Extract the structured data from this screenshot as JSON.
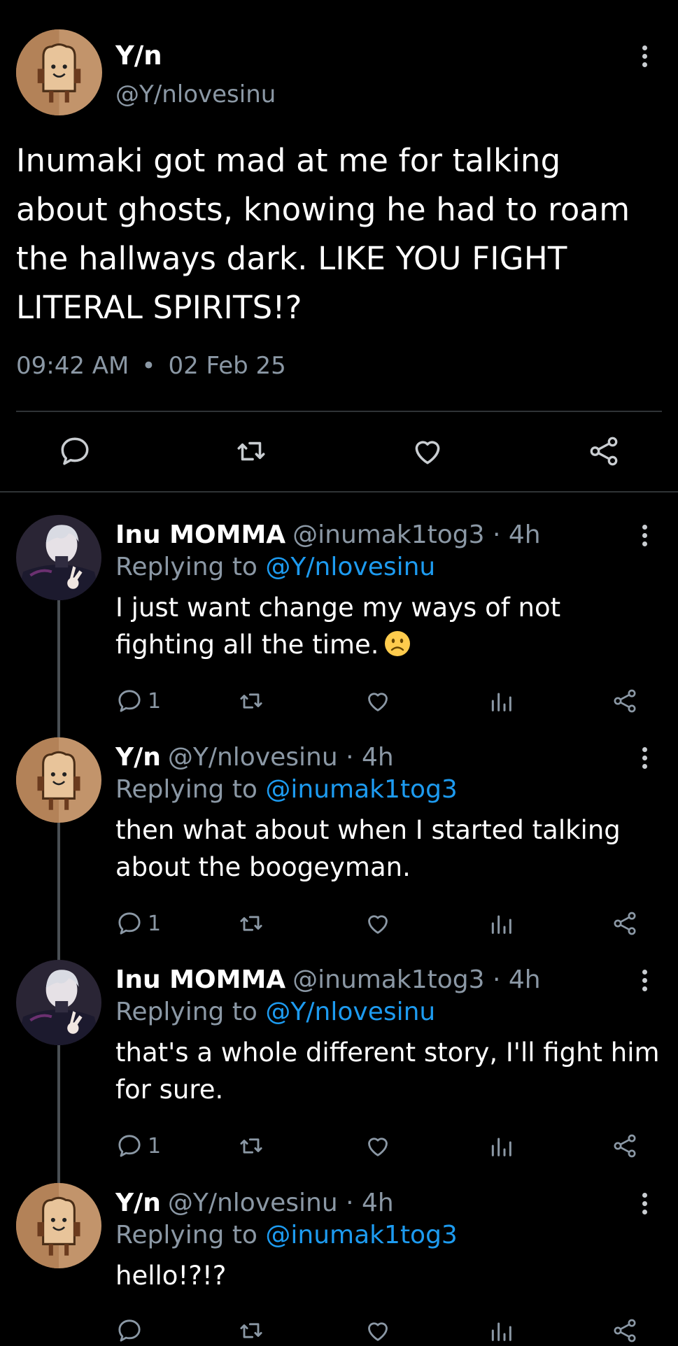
{
  "main_tweet": {
    "name": "Y/n",
    "handle": "@Y/nlovesinu",
    "text": "Inumaki got mad at me for talking about ghosts, knowing he had to roam the hallways dark. LIKE YOU FIGHT LITERAL SPIRITS!?",
    "time": "09:42 AM",
    "separator": "•",
    "date": "02 Feb 25",
    "actions": [
      "reply-icon",
      "retweet-icon",
      "like-icon",
      "share-icon"
    ]
  },
  "replies": [
    {
      "name": "Inu MOMMA",
      "handle_time": "@inumak1tog3 · 4h",
      "replying_prefix": "Replying to",
      "replying_to": "@Y/nlovesinu",
      "text": "I just want change my ways of not fighting all the time.",
      "emoji": "slightly-frowning-face-icon",
      "reply_count": "1"
    },
    {
      "name": "Y/n",
      "handle_time": "@Y/nlovesinu · 4h",
      "replying_prefix": "Replying to",
      "replying_to": "@inumak1tog3",
      "text": "then what about when I started talking about the boogeyman.",
      "reply_count": "1"
    },
    {
      "name": "Inu MOMMA",
      "handle_time": "@inumak1tog3 · 4h",
      "replying_prefix": "Replying to",
      "replying_to": "@Y/nlovesinu",
      "text": "that's a whole different story, I'll fight him for sure.",
      "reply_count": "1"
    },
    {
      "name": "Y/n",
      "handle_time": "@Y/nlovesinu · 4h",
      "replying_prefix": "Replying to",
      "replying_to": "@inumak1tog3",
      "text": "hello!?!?",
      "reply_count": ""
    }
  ],
  "colors": {
    "background": "#000000",
    "muted": "#8b98a5",
    "link": "#1d9bf0",
    "divider": "#2f3336"
  }
}
